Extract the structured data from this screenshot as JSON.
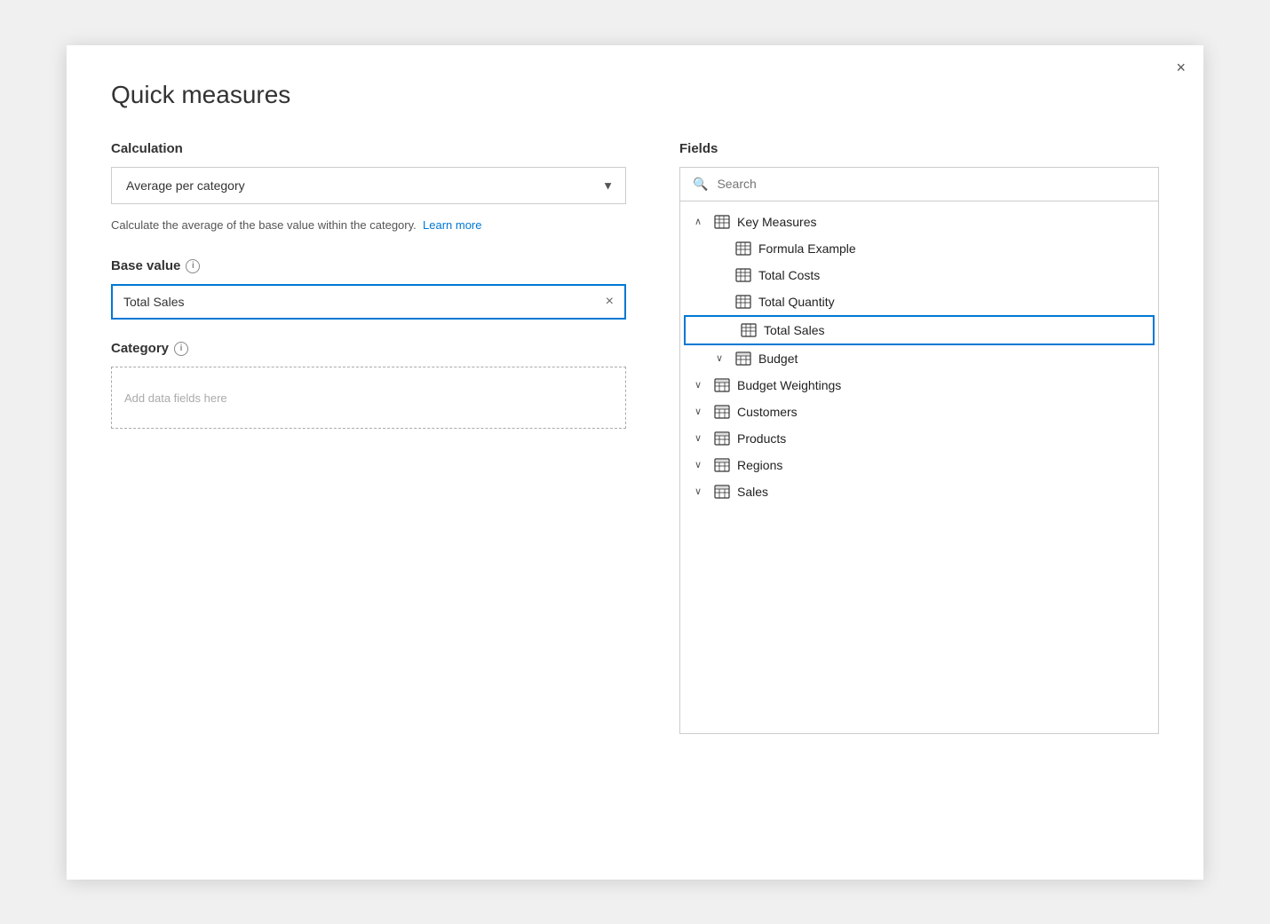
{
  "dialog": {
    "title": "Quick measures",
    "close_label": "×"
  },
  "left": {
    "calculation_label": "Calculation",
    "dropdown_value": "Average per category",
    "dropdown_arrow": "▼",
    "description": "Calculate the average of the base value within the category.",
    "learn_more": "Learn more",
    "base_value_label": "Base value",
    "base_value_value": "Total Sales",
    "clear_icon": "×",
    "category_label": "Category",
    "category_placeholder": "Add data fields here"
  },
  "right": {
    "fields_label": "Fields",
    "search_placeholder": "Search",
    "tree": [
      {
        "id": "key-measures",
        "type": "group-header",
        "label": "Key Measures",
        "chevron": "∧",
        "icon": "measure"
      },
      {
        "id": "formula-example",
        "type": "child",
        "label": "Formula Example",
        "icon": "measure"
      },
      {
        "id": "total-costs",
        "type": "child",
        "label": "Total Costs",
        "icon": "measure"
      },
      {
        "id": "total-quantity",
        "type": "child",
        "label": "Total Quantity",
        "icon": "measure"
      },
      {
        "id": "total-sales",
        "type": "child",
        "label": "Total Sales",
        "icon": "measure",
        "highlighted": true
      },
      {
        "id": "budget",
        "type": "group-header",
        "label": "Budget",
        "chevron": "∨",
        "icon": "table",
        "indent": true
      },
      {
        "id": "budget-weightings",
        "type": "group-header",
        "label": "Budget Weightings",
        "chevron": "∨",
        "icon": "table"
      },
      {
        "id": "customers",
        "type": "group-header",
        "label": "Customers",
        "chevron": "∨",
        "icon": "table"
      },
      {
        "id": "products",
        "type": "group-header",
        "label": "Products",
        "chevron": "∨",
        "icon": "table"
      },
      {
        "id": "regions",
        "type": "group-header",
        "label": "Regions",
        "chevron": "∨",
        "icon": "table"
      },
      {
        "id": "sales",
        "type": "group-header",
        "label": "Sales",
        "chevron": "∨",
        "icon": "table"
      }
    ]
  }
}
